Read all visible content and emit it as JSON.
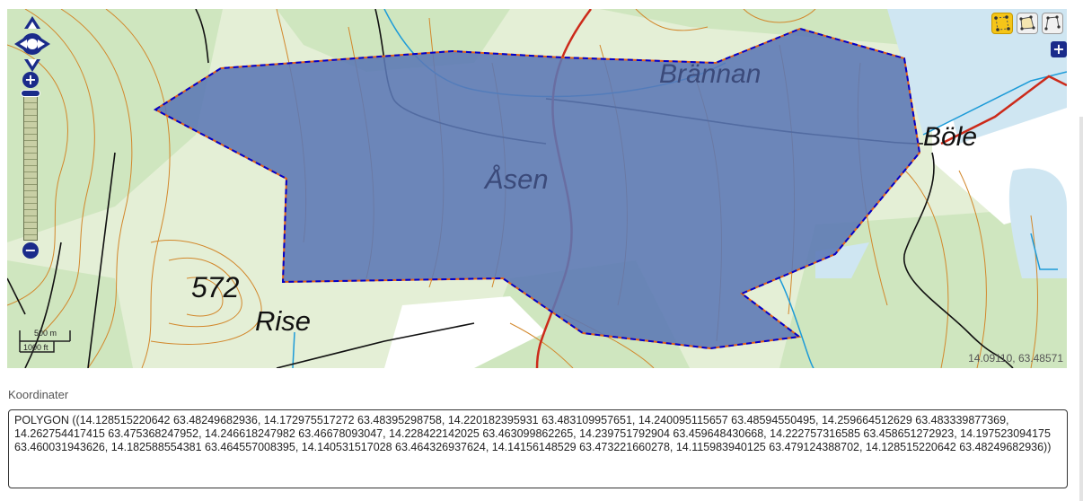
{
  "map": {
    "place_labels": {
      "brannan": "Brännan",
      "asen": "Åsen",
      "bole": "Böle",
      "elevation": "572",
      "rise": "Rise"
    },
    "scale": {
      "top": "500 m",
      "bottom": "1000 ft"
    },
    "cursor_coordinates": "14.09110, 63.48571",
    "polygon_fill": "#5b78b5",
    "polygon_stroke": "#0000cc",
    "polygon_stroke_accent": "#e0601a",
    "water_color": "#cfe6f2",
    "forest_color": "#cfe6bf",
    "contour_color": "#d2872b",
    "road_color": "#cc2a1a",
    "controls": {
      "zoom_in": "+",
      "zoom_out": "−",
      "add_layer": "+"
    },
    "toolbar": {
      "tools": [
        {
          "name": "draw-points-tool-icon",
          "active": true
        },
        {
          "name": "modify-polygon-tool-icon",
          "active": false
        },
        {
          "name": "draw-polygon-tool-icon",
          "active": false
        }
      ]
    }
  },
  "form": {
    "label": "Koordinater",
    "value": "POLYGON ((14.128515220642 63.48249682936, 14.172975517272 63.48395298758, 14.220182395931 63.483109957651, 14.240095115657 63.48594550495, 14.259664512629 63.483339877369, 14.262754417415 63.475368247952, 14.246618247982 63.46678093047, 14.228422142025 63.463099862265, 14.239751792904 63.459648430668, 14.222757316585 63.458651272923, 14.197523094175 63.460031943626, 14.182588554381 63.464557008395, 14.140531517028 63.464326937624, 14.14156148529 63.473221660278, 14.115983940125 63.479124388702, 14.128515220642 63.48249682936))"
  }
}
